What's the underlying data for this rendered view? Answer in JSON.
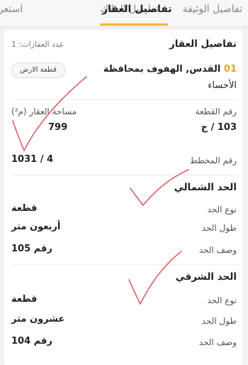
{
  "tabs": [
    {
      "label": "تفاصيل الوثيقة",
      "active": false
    },
    {
      "label": "تفاصيل الملاك",
      "active": false
    },
    {
      "label": "تفاصيل العقار",
      "active": true
    },
    {
      "label": "استعرا",
      "active": false
    }
  ],
  "property": {
    "title": "تفاصيل العقار",
    "count_label": "عدد العقارات: 1",
    "index": "01",
    "name_line1": "القدس, الهفوف بمحافظة",
    "name_line2": "الأحساء",
    "type_chip": "قطعة الارض",
    "plot_number_label": "رقم القطعة",
    "plot_number_value": "103 / ج",
    "area_label": "مساحة العقار (م²)",
    "area_value": "799",
    "plan_number_label": "رقم المخطط",
    "plan_number_value": "1031 / 4"
  },
  "north_boundary": {
    "title": "الحد الشمالي",
    "type_label": "نوع الحد",
    "type_value": "قطعة",
    "length_label": "طول الحد",
    "length_value": "أربعون متر",
    "desc_label": "وصف الحد",
    "desc_value": "رقم 105"
  },
  "east_boundary": {
    "title": "الحد الشرقي",
    "type_label": "نوع الحد",
    "type_value": "قطعة",
    "length_label": "طول الحد",
    "length_value": "عشرون متر",
    "desc_label": "وصف الحد",
    "desc_value": "رقم 104"
  },
  "colors": {
    "accent": "#f2b33d",
    "index": "#e6a623",
    "check_mark": "#d9343f"
  }
}
